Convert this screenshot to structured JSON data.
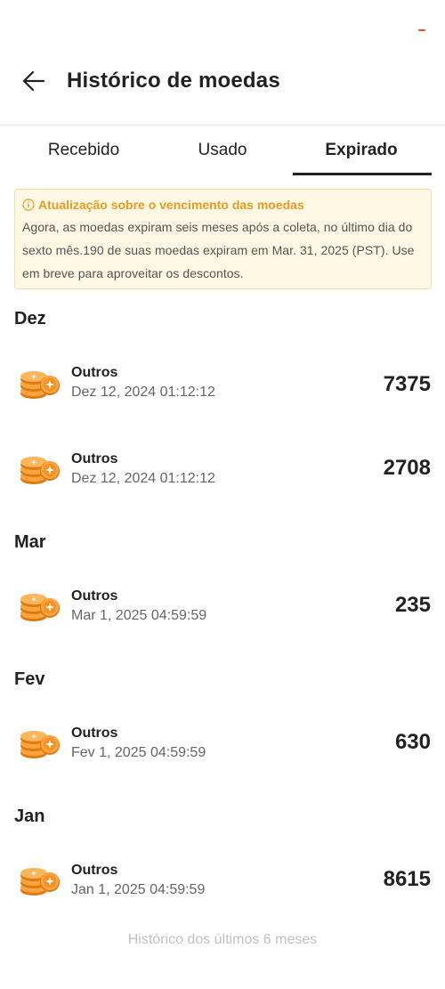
{
  "header": {
    "title": "Histórico de moedas",
    "back_icon": "arrow-left-icon"
  },
  "tabs": [
    {
      "label": "Recebido",
      "active": false
    },
    {
      "label": "Usado",
      "active": false
    },
    {
      "label": "Expirado",
      "active": true
    }
  ],
  "notice": {
    "title": "Atualização sobre o vencimento das moedas",
    "body": "Agora, as moedas expiram seis meses após a coleta, no último dia do sexto mês.190 de suas moedas expiram em Mar. 31, 2025 (PST). Use em breve para aproveitar os descontos.",
    "accent_color": "#eb9a22",
    "background_color": "#fff8e4"
  },
  "sections": [
    {
      "title": "Dez",
      "items": [
        {
          "name": "Outros",
          "date": "Dez 12, 2024 01:12:12",
          "amount": "7375"
        },
        {
          "name": "Outros",
          "date": "Dez 12, 2024 01:12:12",
          "amount": "2708"
        }
      ]
    },
    {
      "title": "Mar",
      "items": [
        {
          "name": "Outros",
          "date": "Mar 1, 2025 04:59:59",
          "amount": "235"
        }
      ]
    },
    {
      "title": "Fev",
      "items": [
        {
          "name": "Outros",
          "date": "Fev 1, 2025 04:59:59",
          "amount": "630"
        }
      ]
    },
    {
      "title": "Jan",
      "items": [
        {
          "name": "Outros",
          "date": "Jan 1, 2025 04:59:59",
          "amount": "8615"
        }
      ]
    }
  ],
  "footer": {
    "text": "Histórico dos últimos 6 meses"
  },
  "colors": {
    "brand": "#ee4d2d",
    "coin": "#f7901e"
  }
}
